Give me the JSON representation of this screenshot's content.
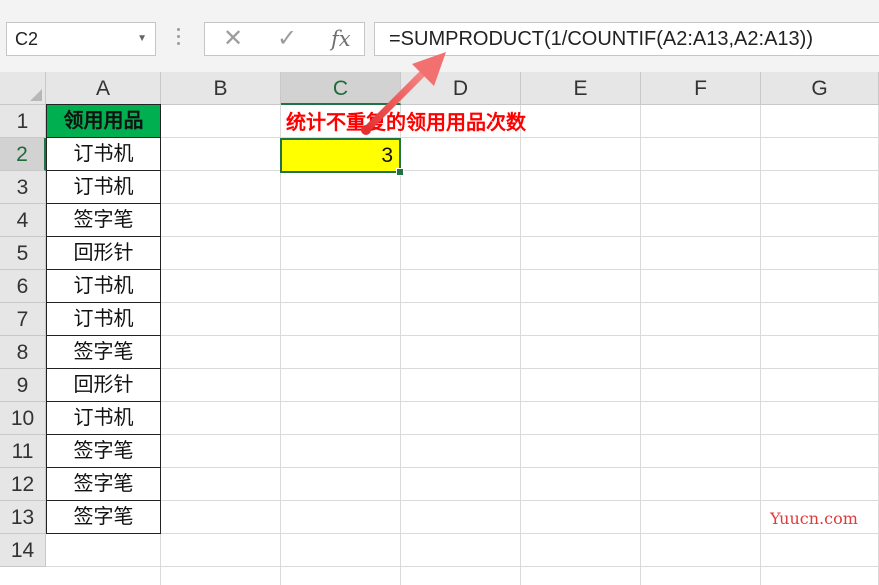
{
  "namebox": {
    "value": "C2"
  },
  "formula_bar": {
    "cancel_icon": "close-icon",
    "enter_icon": "check-icon",
    "fx_label": "fx",
    "formula": "=SUMPRODUCT(1/COUNTIF(A2:A13,A2:A13))"
  },
  "columns": [
    "A",
    "B",
    "C",
    "D",
    "E",
    "F",
    "G"
  ],
  "rows": [
    "1",
    "2",
    "3",
    "4",
    "5",
    "6",
    "7",
    "8",
    "9",
    "10",
    "11",
    "12",
    "13",
    "14"
  ],
  "active_cell": {
    "column": "C",
    "row": "2",
    "value": "3"
  },
  "column_a": {
    "header": "领用用品",
    "items": [
      "订书机",
      "订书机",
      "签字笔",
      "回形针",
      "订书机",
      "订书机",
      "签字笔",
      "回形针",
      "订书机",
      "签字笔",
      "签字笔",
      "签字笔"
    ]
  },
  "annotation": "统计不重复的领用用品次数",
  "watermark": "Yuucn.com",
  "colors": {
    "header_fill": "#00b050",
    "highlight_fill": "#ffff00",
    "annotation": "#ff0000",
    "arrow": "#f06060",
    "selection": "#217346"
  }
}
